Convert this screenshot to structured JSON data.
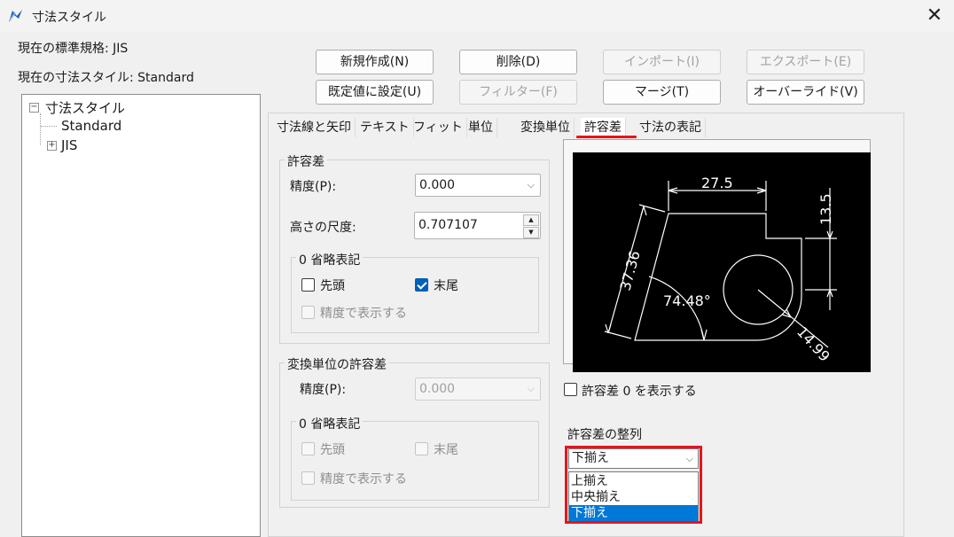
{
  "window": {
    "title": "寸法スタイル",
    "close": "✕"
  },
  "info": {
    "standard": "現在の標準規格: JIS",
    "current_style": "現在の寸法スタイル: Standard"
  },
  "buttons": {
    "new": "新規作成(N)",
    "delete": "削除(D)",
    "import": "インポート(I)",
    "export": "エクスポート(E)",
    "set_default": "既定値に設定(U)",
    "filter": "フィルター(F)",
    "merge": "マージ(T)",
    "override": "オーバーライド(V)"
  },
  "tree": {
    "root": "寸法スタイル",
    "items": [
      "Standard",
      "JIS"
    ],
    "toggle_root": "−",
    "toggle_child": "+"
  },
  "tabs": [
    "寸法線と矢印",
    "テキスト",
    "フィット",
    "単位",
    "変換単位",
    "許容差",
    "寸法の表記"
  ],
  "active_tab": "許容差",
  "tolerance": {
    "group_title": "許容差",
    "precision_label": "精度(P):",
    "precision_value": "0.000",
    "height_label": "高さの尺度:",
    "height_value": "0.707107",
    "zero_group_title": "0 省略表記",
    "leading_label": "先頭",
    "leading_checked": false,
    "trailing_label": "末尾",
    "trailing_checked": true,
    "by_precision_label": "精度で表示する"
  },
  "alt_tolerance": {
    "group_title": "変換単位の許容差",
    "precision_label": "精度(P):",
    "precision_value": "0.000",
    "zero_group_title": "0 省略表記",
    "leading_label": "先頭",
    "trailing_label": "末尾",
    "by_precision_label": "精度で表示する"
  },
  "preview": {
    "dim_top": "27.5",
    "dim_right": "13.5",
    "dim_left": "37.36",
    "dim_angle": "74.48°",
    "dim_radius": "14.99"
  },
  "show_zero": {
    "label": "許容差 0 を表示する",
    "checked": false
  },
  "alignment": {
    "label": "許容差の整列",
    "selected": "下揃え",
    "options": [
      "上揃え",
      "中央揃え",
      "下揃え"
    ]
  },
  "colors": {
    "highlight": "#e8141c",
    "accent": "#005fb8",
    "selection": "#0078d7"
  }
}
